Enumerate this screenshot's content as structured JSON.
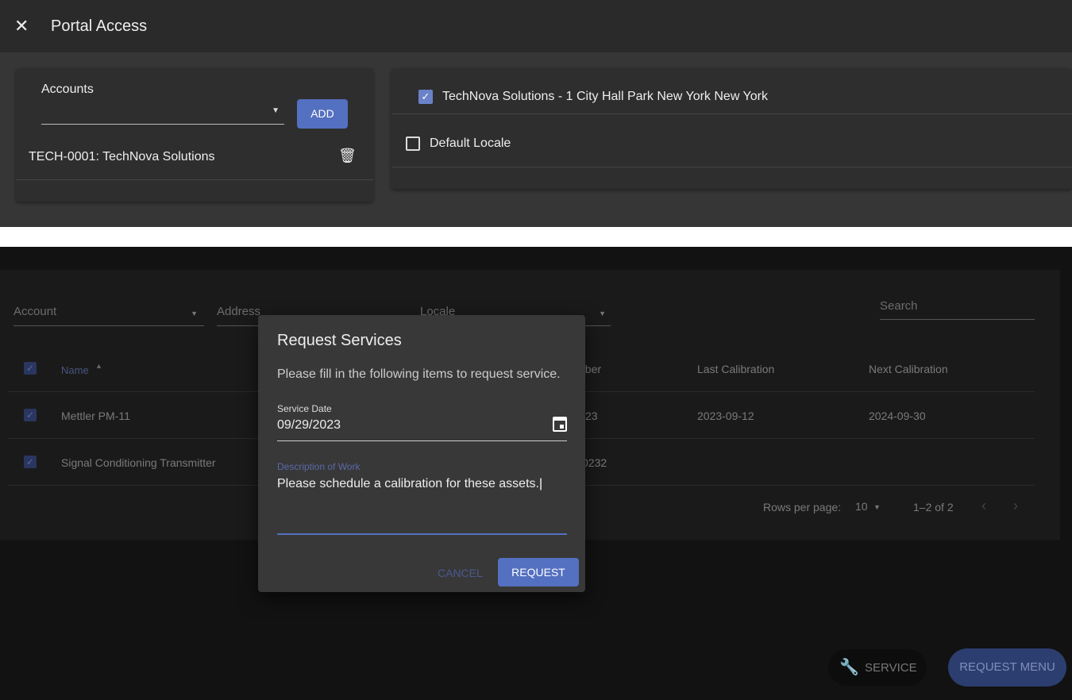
{
  "header": {
    "title": "Portal Access",
    "close_icon": "close-icon"
  },
  "accounts": {
    "label": "Accounts",
    "add_label": "ADD",
    "items": [
      {
        "label": "TECH-0001: TechNova Solutions"
      }
    ]
  },
  "locations": {
    "items": [
      {
        "label": "TechNova Solutions - 1 City Hall Park New York New York",
        "checked": true
      },
      {
        "label": "Default Locale",
        "checked": false
      }
    ]
  },
  "filters": {
    "account": "Account",
    "address": "Address",
    "locale": "Locale",
    "search_placeholder": "Search"
  },
  "table": {
    "columns": {
      "name": "Name",
      "partial": "nber",
      "last": "Last Calibration",
      "next": "Next Calibration"
    },
    "rows": [
      {
        "name": "Mettler PM-11",
        "partial": "23",
        "last": "2023-09-12",
        "next": "2024-09-30",
        "checked": true
      },
      {
        "name": "Signal Conditioning Transmitter",
        "partial": "0232",
        "last": "",
        "next": "",
        "checked": true
      }
    ],
    "pagination": {
      "rows_per_page_label": "Rows per page:",
      "rows_per_page": "10",
      "range": "1–2 of 2"
    }
  },
  "dialog": {
    "title": "Request Services",
    "intro": "Please fill in the following items to request service.",
    "date_label": "Service Date",
    "date_value": "09/29/2023",
    "desc_label": "Description of Work",
    "desc_value": "Please schedule a calibration for these assets.",
    "cancel": "CANCEL",
    "request": "REQUEST"
  },
  "fab": {
    "service": "SERVICE",
    "request_menu": "REQUEST MENU"
  },
  "colors": {
    "accent": "#5470c0"
  }
}
